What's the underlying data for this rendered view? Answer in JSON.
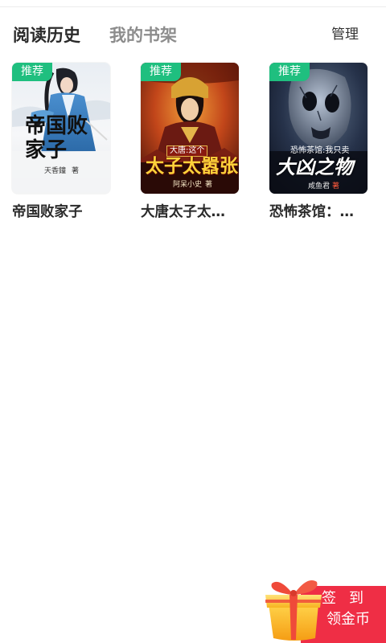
{
  "tabs": {
    "reading_history": "阅读历史",
    "my_bookshelf": "我的书架"
  },
  "manage_label": "管理",
  "recommend_badge": "推荐",
  "badge_color": "#1fbf7f",
  "books": [
    {
      "title": "帝国败家子",
      "cover_title": "帝国败家子",
      "cover_author": "天香鐘",
      "cover_author_suffix": "著"
    },
    {
      "title": "大唐太子太…",
      "cover_title_small": "大唐:这个",
      "cover_title": "太子太嚣张",
      "cover_author": "阿呆小史",
      "cover_author_suffix": "著"
    },
    {
      "title": "恐怖茶馆：…",
      "cover_title_small": "恐怖茶馆:我只卖",
      "cover_title": "大凶之物",
      "cover_author": "咸鱼君",
      "cover_author_suffix": "著"
    }
  ],
  "checkin": {
    "line1": "签到",
    "line2": "领金币",
    "color": "#ef2e45"
  }
}
